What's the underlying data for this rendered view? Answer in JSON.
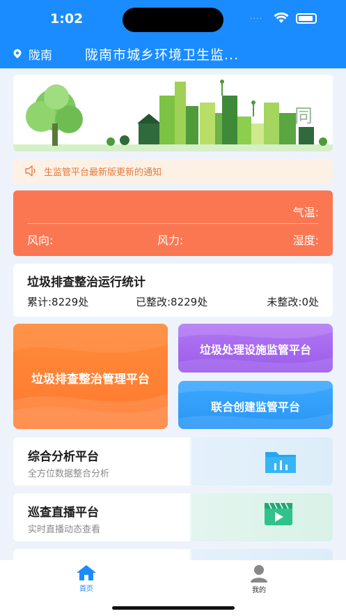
{
  "status_bar": {
    "time": "1:02",
    "dots": "····"
  },
  "header": {
    "location": "陇南",
    "title": "陇南市城乡环境卫生监..."
  },
  "notice": {
    "text": "生监管平台最新版更新的通知"
  },
  "weather": {
    "temperature_label": "气温:",
    "wind_dir_label": "风向:",
    "wind_power_label": "风力:",
    "humidity_label": "湿度:"
  },
  "stats": {
    "title": "垃圾排查整治运行统计",
    "total": "累计:8229处",
    "rectified": "已整改:8229处",
    "unrectified": "未整改:0处"
  },
  "platforms": {
    "big": {
      "label": "垃圾排查整治管理平台",
      "color": "#ff7f32"
    },
    "top_right": {
      "label": "垃圾处理设施监管平台",
      "color": "#a86af0"
    },
    "bottom_right": {
      "label": "联合创建监管平台",
      "color": "#3aa3fb"
    }
  },
  "list": [
    {
      "title": "综合分析平台",
      "subtitle": "全方位数据整合分析",
      "icon": "folder-chart-icon"
    },
    {
      "title": "巡查直播平台",
      "subtitle": "实时直播动态查看",
      "icon": "video-play-icon"
    }
  ],
  "tabbar": {
    "home": {
      "label": "首页",
      "icon": "home-icon",
      "active": true
    },
    "mine": {
      "label": "我的",
      "icon": "user-icon",
      "active": false
    }
  },
  "colors": {
    "primary": "#1a8cff",
    "weather_bg": "#fa7752",
    "notice_text": "#e47a3c"
  }
}
